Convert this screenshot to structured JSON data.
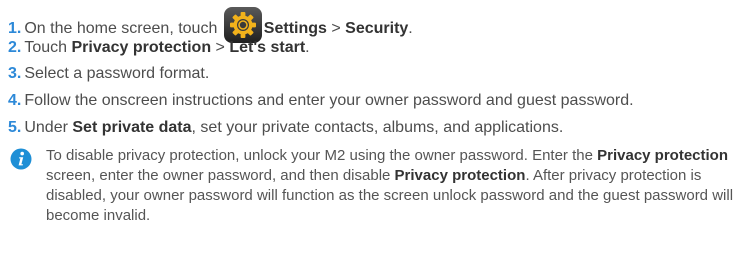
{
  "steps": [
    {
      "num": "1.",
      "t1": "On the home screen, touch",
      "b1": "Settings",
      "sep": " > ",
      "b2": "Security",
      "end": ".",
      "icon": "settings-gear-icon"
    },
    {
      "num": "2.",
      "t1": "Touch ",
      "b1": "Privacy protection",
      "sep": " > ",
      "b2": "Let's start",
      "end": "."
    },
    {
      "num": "3.",
      "t1": "Select a password format."
    },
    {
      "num": "4.",
      "t1": "Follow the onscreen instructions and enter your owner password and guest password."
    },
    {
      "num": "5.",
      "t1": "Under ",
      "b1": "Set private data",
      "t2": ", set your private contacts, albums, and applications."
    }
  ],
  "note": {
    "icon": "info-icon",
    "t1": "To disable privacy protection, unlock your M2 using the owner password. Enter the ",
    "b1": "Privacy protection",
    "t2": " screen, enter the owner password, and then disable ",
    "b2": "Privacy protection",
    "t3": ". After privacy protection is disabled, your owner password will function as the screen unlock password and the guest password will become invalid."
  },
  "colors": {
    "step_number": "#2d89d8",
    "info_icon": "#1e8fd6",
    "gear_background": "#3a3a3a",
    "gear": "#f2b21b"
  }
}
